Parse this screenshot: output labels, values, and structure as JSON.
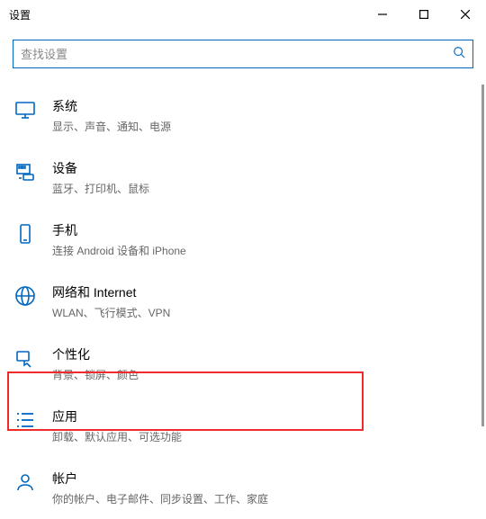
{
  "window": {
    "title": "设置"
  },
  "search": {
    "placeholder": "查找设置"
  },
  "categories": [
    {
      "key": "system",
      "title": "系统",
      "desc": "显示、声音、通知、电源"
    },
    {
      "key": "devices",
      "title": "设备",
      "desc": "蓝牙、打印机、鼠标"
    },
    {
      "key": "phone",
      "title": "手机",
      "desc": "连接 Android 设备和 iPhone"
    },
    {
      "key": "network",
      "title": "网络和 Internet",
      "desc": "WLAN、飞行模式、VPN"
    },
    {
      "key": "personalize",
      "title": "个性化",
      "desc": "背景、锁屏、颜色"
    },
    {
      "key": "apps",
      "title": "应用",
      "desc": "卸载、默认应用、可选功能"
    },
    {
      "key": "accounts",
      "title": "帐户",
      "desc": "你的帐户、电子邮件、同步设置、工作、家庭"
    }
  ]
}
